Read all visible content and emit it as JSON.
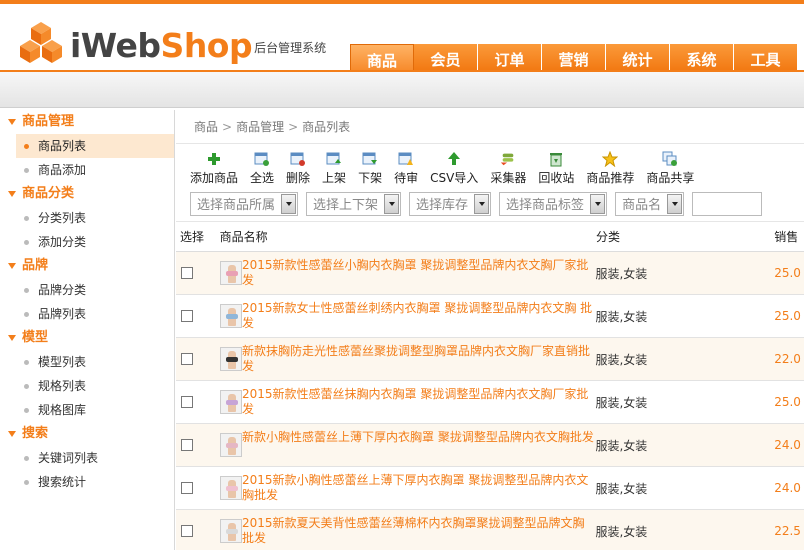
{
  "brand": {
    "logo_prefix": "iWeb",
    "logo_suffix": "Shop",
    "subtitle": "后台管理系统",
    "accent": "#f37e1a"
  },
  "nav": {
    "tabs": [
      "商品",
      "会员",
      "订单",
      "营销",
      "统计",
      "系统",
      "工具"
    ],
    "active": "商品"
  },
  "sidebar": {
    "groups": [
      {
        "title": "商品管理",
        "items": [
          "商品列表",
          "商品添加"
        ]
      },
      {
        "title": "商品分类",
        "items": [
          "分类列表",
          "添加分类"
        ]
      },
      {
        "title": "品牌",
        "items": [
          "品牌分类",
          "品牌列表"
        ]
      },
      {
        "title": "模型",
        "items": [
          "模型列表",
          "规格列表",
          "规格图库"
        ]
      },
      {
        "title": "搜索",
        "items": [
          "关键词列表",
          "搜索统计"
        ]
      }
    ],
    "active_item": "商品列表"
  },
  "breadcrumb": [
    "商品",
    "商品管理",
    "商品列表"
  ],
  "toolbar": [
    {
      "label": "添加商品",
      "icon": "plus-icon"
    },
    {
      "label": "全选",
      "icon": "select-all-icon"
    },
    {
      "label": "删除",
      "icon": "delete-icon"
    },
    {
      "label": "上架",
      "icon": "shelf-up-icon"
    },
    {
      "label": "下架",
      "icon": "shelf-down-icon"
    },
    {
      "label": "待审",
      "icon": "pending-icon"
    },
    {
      "label": "CSV导入",
      "icon": "csv-import-icon"
    },
    {
      "label": "采集器",
      "icon": "collector-icon"
    },
    {
      "label": "回收站",
      "icon": "recycle-bin-icon"
    },
    {
      "label": "商品推荐",
      "icon": "star-icon"
    },
    {
      "label": "商品共享",
      "icon": "share-icon"
    }
  ],
  "filters": [
    {
      "placeholder": "选择商品所属"
    },
    {
      "placeholder": "选择上下架"
    },
    {
      "placeholder": "选择库存"
    },
    {
      "placeholder": "选择商品标签"
    },
    {
      "placeholder": "商品名"
    }
  ],
  "table": {
    "headers": {
      "select": "选择",
      "name": "商品名称",
      "category": "分类",
      "sales": "销售"
    },
    "rows": [
      {
        "name": "2015新款性感蕾丝小胸内衣胸罩 聚拢调整型品牌内衣文胸厂家批发",
        "category": "服装,女装",
        "price": "25.0",
        "bra": "#e9a0b4"
      },
      {
        "name": "2015新款女士性感蕾丝刺绣内衣胸罩 聚拢调整型品牌内衣文胸 批发",
        "category": "服装,女装",
        "price": "25.0",
        "bra": "#8fb6d9"
      },
      {
        "name": "新款抹胸防走光性感蕾丝聚拢调整型胸罩品牌内衣文胸厂家直销批发",
        "category": "服装,女装",
        "price": "22.0",
        "bra": "#333333"
      },
      {
        "name": "2015新款性感蕾丝抹胸内衣胸罩 聚拢调整型品牌内衣文胸厂家批发",
        "category": "服装,女装",
        "price": "25.0",
        "bra": "#c7a4d6"
      },
      {
        "name": "新款小胸性感蕾丝上薄下厚内衣胸罩 聚拢调整型品牌内衣文胸批发",
        "category": "服装,女装",
        "price": "24.0",
        "bra": "#e5b7c4"
      },
      {
        "name": "2015新款小胸性感蕾丝上薄下厚内衣胸罩 聚拢调整型品牌内衣文胸批发",
        "category": "服装,女装",
        "price": "24.0",
        "bra": "#f0c0cf"
      },
      {
        "name": "2015新款夏天美背性感蕾丝薄棉杯内衣胸罩聚拢调整型品牌文胸批发",
        "category": "服装,女装",
        "price": "22.5",
        "bra": "#d9d9d9"
      }
    ]
  }
}
